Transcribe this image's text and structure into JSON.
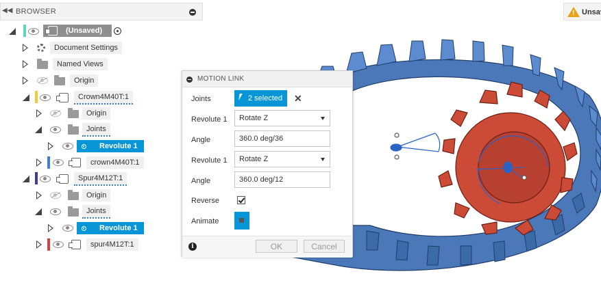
{
  "browser": {
    "collapse_glyph": "◀◀",
    "title": "BROWSER",
    "root_label": "(Unsaved)",
    "tree": [
      {
        "label": "Document Settings"
      },
      {
        "label": "Named Views"
      },
      {
        "label": "Origin"
      },
      {
        "label": "Crown4M40T:1"
      },
      {
        "label": "Origin"
      },
      {
        "label": "Joints"
      },
      {
        "label": "Revolute 1"
      },
      {
        "label": "crown4M40T:1"
      },
      {
        "label": "Spur4M12T:1"
      },
      {
        "label": "Origin"
      },
      {
        "label": "Joints"
      },
      {
        "label": "Revolute 1"
      },
      {
        "label": "spur4M12T:1"
      }
    ]
  },
  "warning": {
    "text": "Unsav",
    "mark": "!"
  },
  "motion_link": {
    "title": "MOTION LINK",
    "rows": {
      "joints_label": "Joints",
      "joints_value": "2 selected",
      "clear_glyph": "✕",
      "rev1_label": "Revolute 1",
      "rev1_value": "Rotate Z",
      "angle1_label": "Angle",
      "angle1_value": "360.0 deg/36",
      "rev2_label": "Revolute 1",
      "rev2_value": "Rotate Z",
      "angle2_label": "Angle",
      "angle2_value": "360.0 deg/12",
      "reverse_label": "Reverse",
      "reverse_checked": true,
      "animate_label": "Animate"
    },
    "info_glyph": "i",
    "ok_label": "OK",
    "cancel_label": "Cancel"
  },
  "colors": {
    "selection": "#0696d7",
    "crown_gear": "#4a78b8",
    "spur_gear": "#cc4b37",
    "crown_bar": "#f0c93c",
    "crown_body_bar": "#3f7fd6",
    "spur_bar": "#3d3a9e",
    "spur_body_bar": "#d64040",
    "root_bar": "#5fd3c4"
  }
}
